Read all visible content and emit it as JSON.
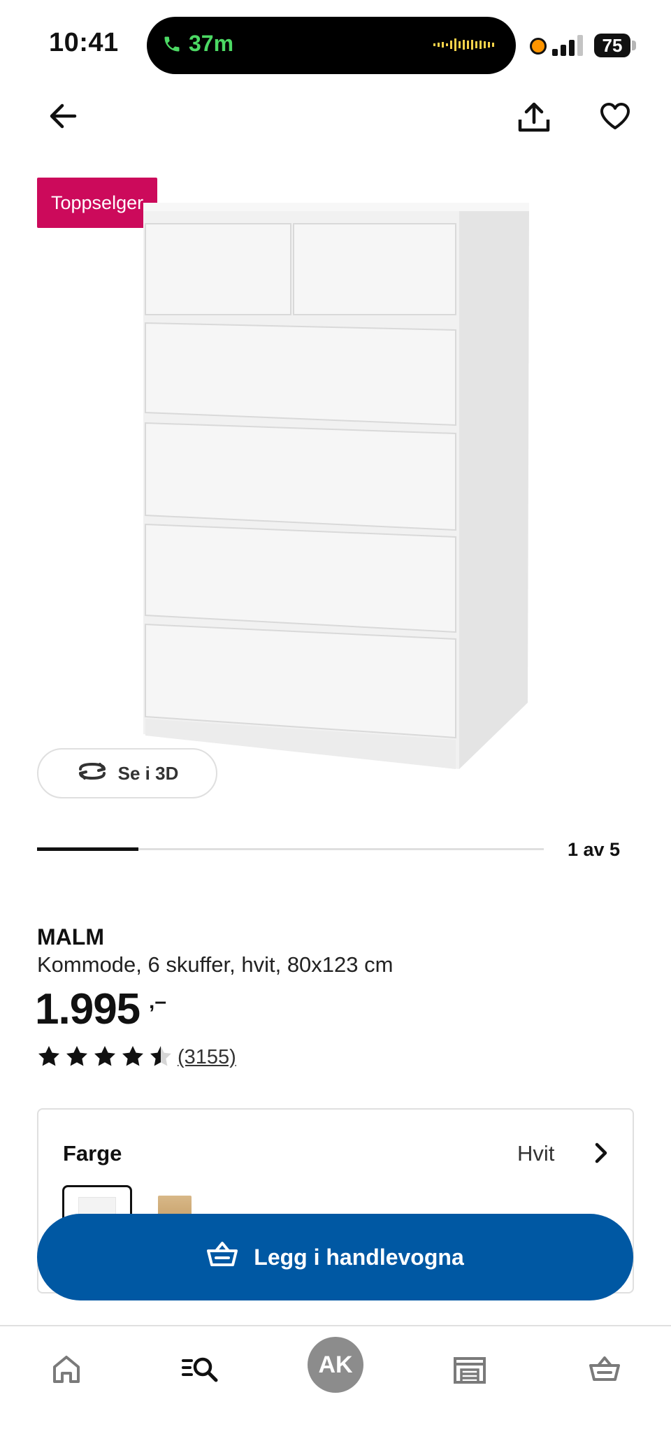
{
  "status_bar": {
    "time": "10:41",
    "call_duration": "37m",
    "battery": "75"
  },
  "header": {
    "back_icon": "arrow-left-icon",
    "share_icon": "share-icon",
    "favorite_icon": "heart-icon"
  },
  "gallery": {
    "badge": "Toppselger",
    "view_3d_label": "Se i 3D",
    "counter": "1 av 5",
    "progress": 0.2
  },
  "product": {
    "name": "MALM",
    "description": "Kommode, 6 skuffer, hvit, 80x123 cm",
    "price": "1.995",
    "price_suffix": ",–",
    "rating": 4.5,
    "review_count": "(3155)"
  },
  "color_selector": {
    "title": "Farge",
    "value": "Hvit",
    "swatches": [
      "white",
      "oak"
    ]
  },
  "cart_button": {
    "label": "Legg i handlevogna"
  },
  "bottom_nav": {
    "avatar_initials": "AK",
    "items": [
      "home-icon",
      "search-icon",
      "avatar",
      "store-icon",
      "cart-icon"
    ]
  },
  "colors": {
    "badge": "#cc0a5b",
    "primary": "#0058a3",
    "call_green": "#4cd964"
  }
}
